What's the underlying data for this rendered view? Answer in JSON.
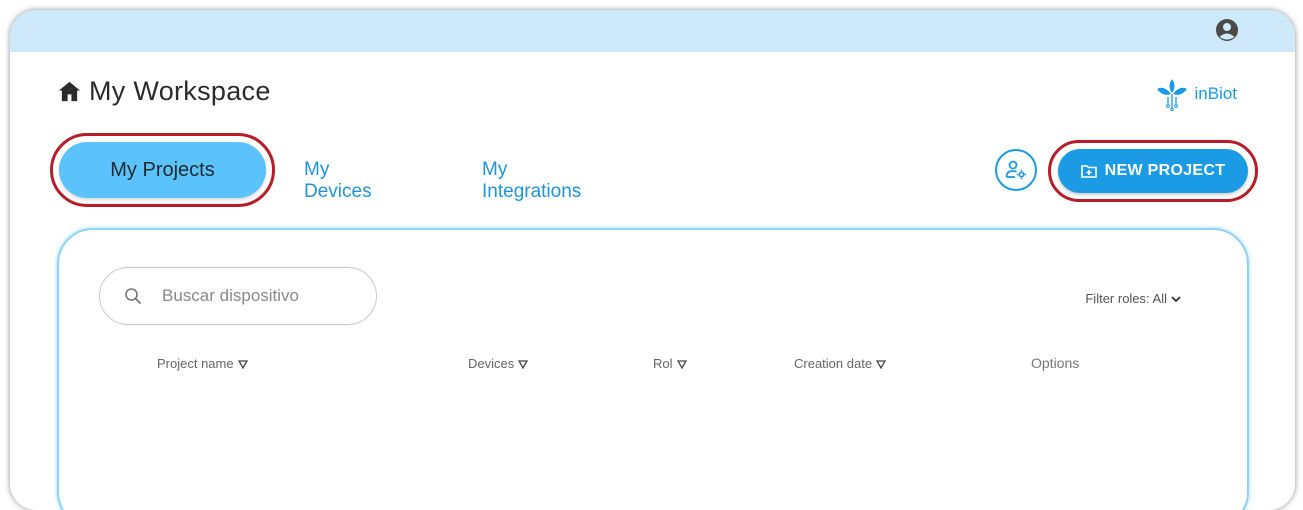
{
  "header": {
    "workspace_title": "My Workspace",
    "logo_text": "inBiot"
  },
  "tabs": [
    {
      "label": "My Projects",
      "active": true
    },
    {
      "label": "My Devices",
      "active": false
    },
    {
      "label": "My Integrations",
      "active": false
    }
  ],
  "actions": {
    "new_project_label": "NEW PROJECT"
  },
  "search": {
    "placeholder": "Buscar dispositivo"
  },
  "filter": {
    "label": "Filter roles: All"
  },
  "table": {
    "columns": [
      "Project name",
      "Devices",
      "Rol",
      "Creation date",
      "Options"
    ]
  },
  "colors": {
    "topbar": "#cde9fa",
    "accent": "#1a9be4",
    "active_tab": "#5cc2fb",
    "highlight": "#b71c28"
  },
  "icons": [
    "account-icon",
    "home-icon",
    "inbiot-logo-icon",
    "user-settings-icon",
    "folder-plus-icon",
    "search-icon",
    "chevron-down-icon",
    "sort-triangle-icon"
  ]
}
